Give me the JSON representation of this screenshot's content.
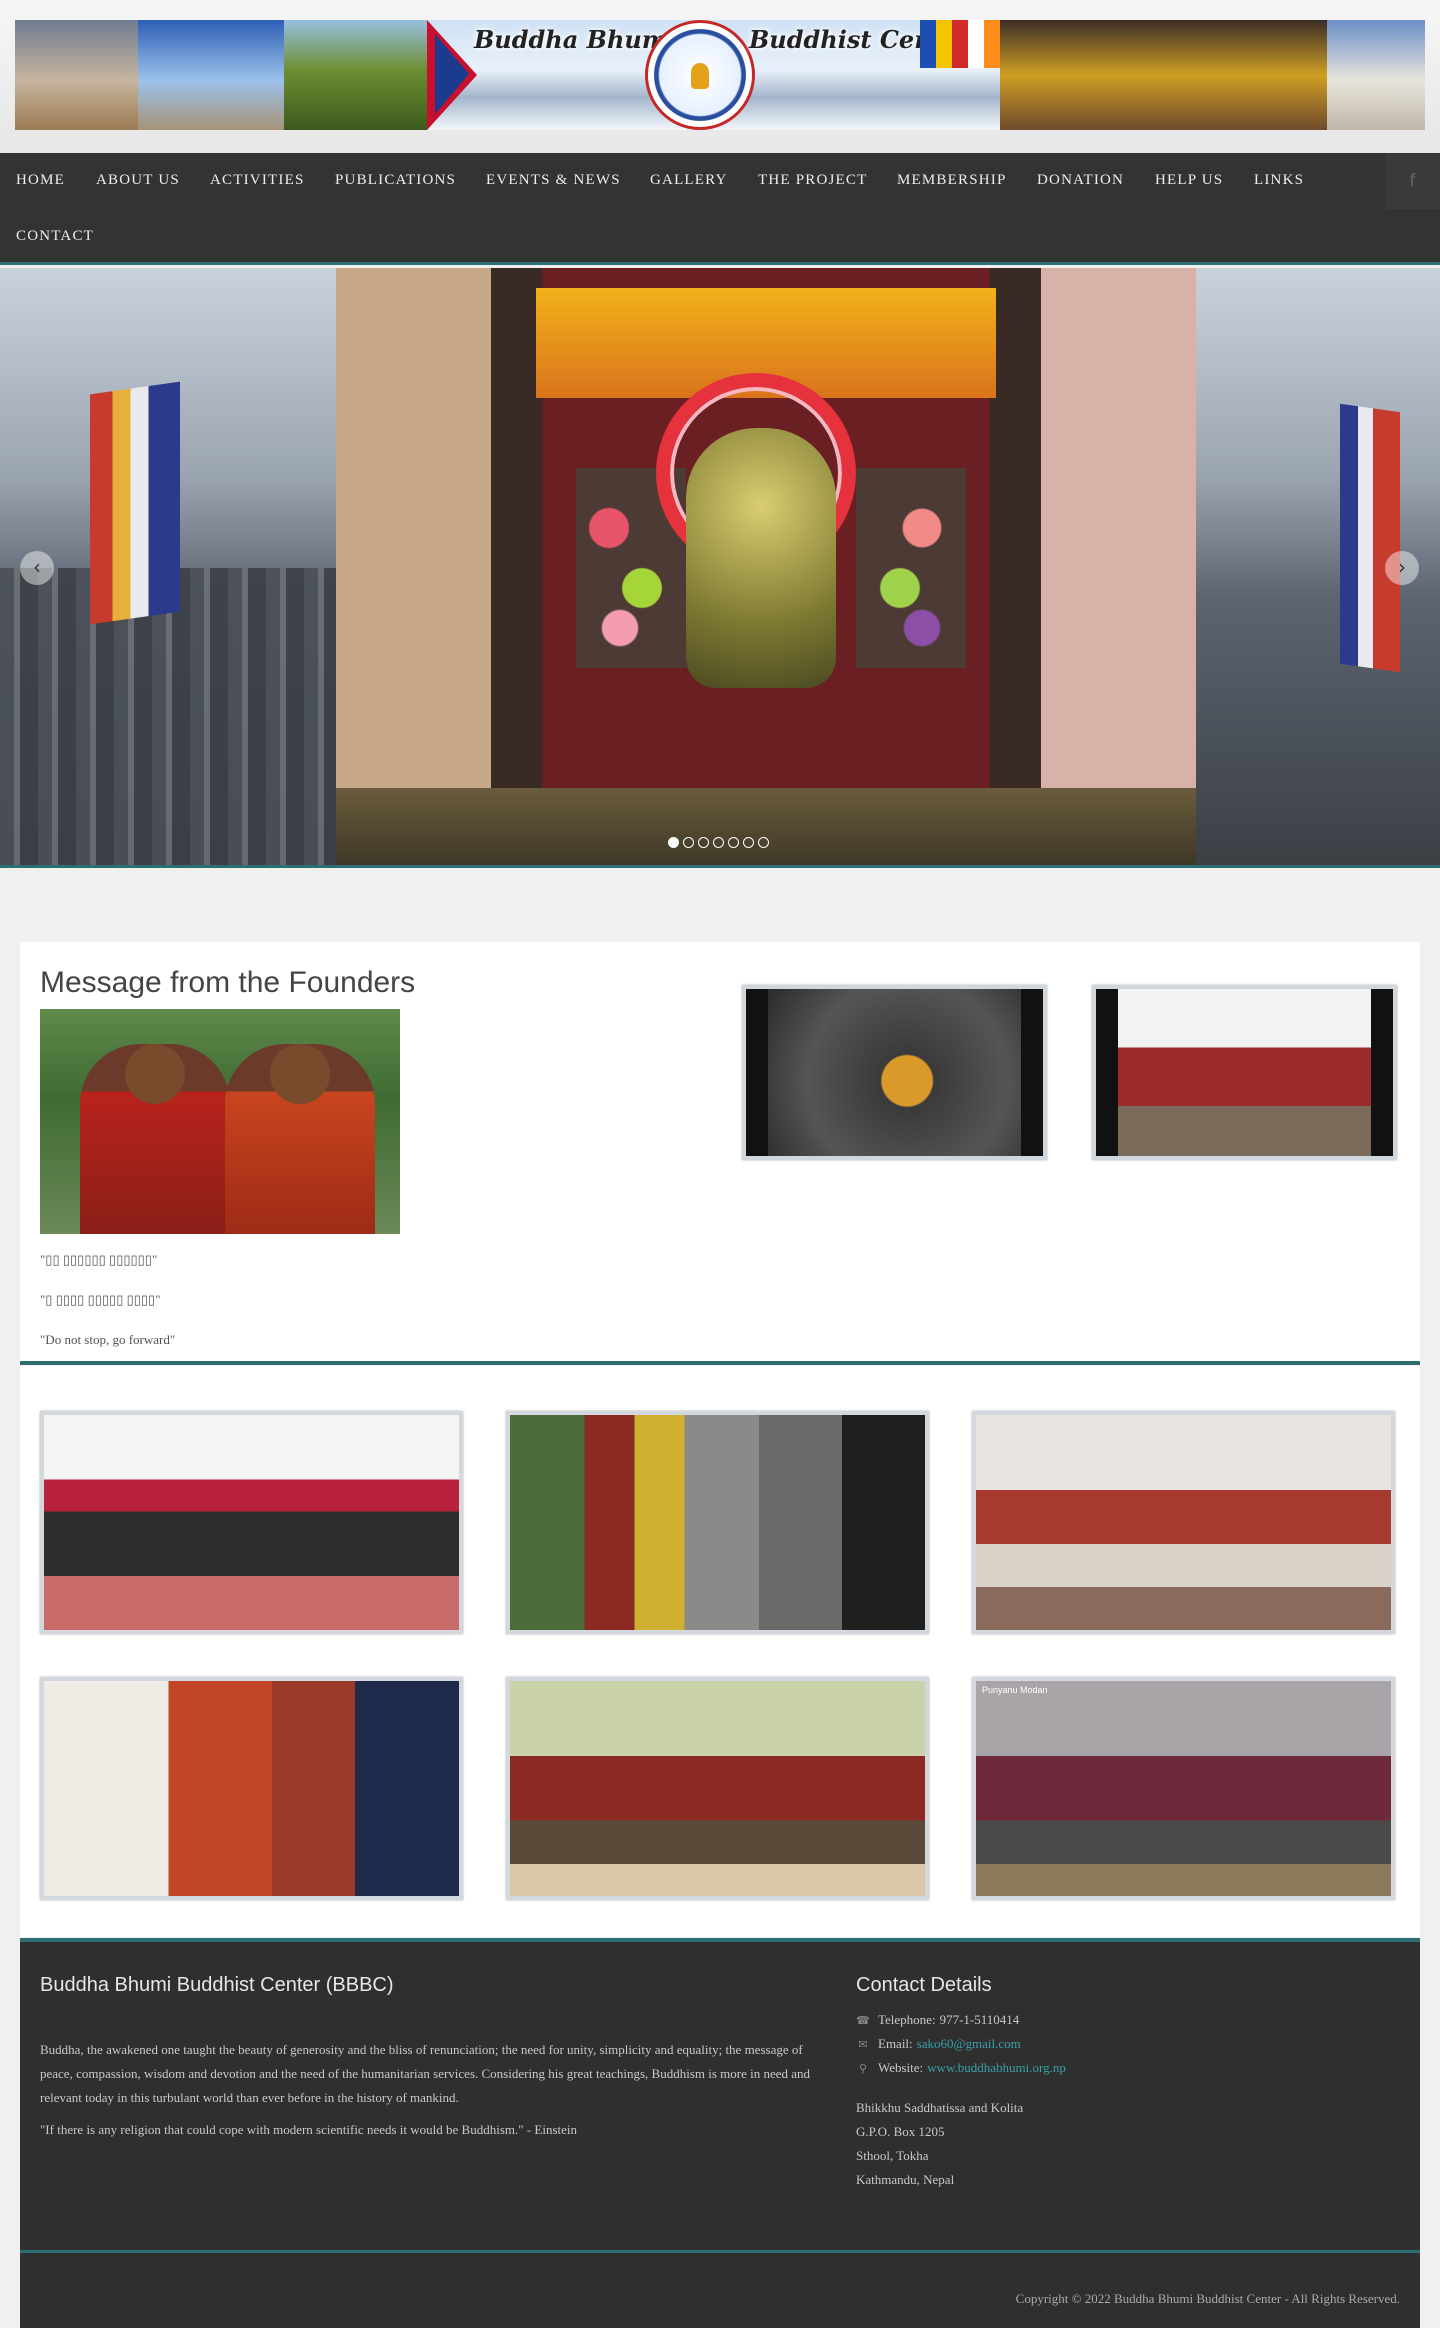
{
  "banner": {
    "title_left": "Buddha Bhumi",
    "title_right": "Buddhist Center"
  },
  "nav": {
    "items": [
      "HOME",
      "ABOUT US",
      "ACTIVITIES",
      "PUBLICATIONS",
      "EVENTS & NEWS",
      "GALLERY",
      "THE PROJECT",
      "MEMBERSHIP",
      "DONATION",
      "HELP US",
      "LINKS",
      "CONTACT"
    ],
    "social_icon": "facebook-icon",
    "social_glyph": "f"
  },
  "slider": {
    "prev_glyph": "‹",
    "next_glyph": "›",
    "slide_count": 7,
    "active_index": 0
  },
  "founders": {
    "title": "Message from the Founders",
    "quotes": [
      "\"▯▯ ▯▯▯▯▯▯ ▯▯▯▯▯▯\"",
      "\"▯ ▯▯▯▯ ▯▯▯▯▯ ▯▯▯▯\"",
      "\"Do not stop, go forward\""
    ]
  },
  "gallery": {
    "caption": "Punyanu Modan"
  },
  "footer": {
    "about_title": "Buddha Bhumi Buddhist Center (BBBC)",
    "about_text": "Buddha, the awakened one taught the beauty of generosity and the bliss of renunciation; the need for unity, simplicity and equality; the message of peace, compassion, wisdom and devotion and the need of the humanitarian services. Considering his great teachings, Buddhism is more in need and relevant today in this turbulant world than ever before in the history of mankind.",
    "einstein_quote": "\"If there is any religion that could cope with modern scientific needs it would be Buddhism.\" - Einstein",
    "contact_title": "Contact Details",
    "telephone_label": "Telephone:",
    "telephone": "977-1-5110414",
    "email_label": "Email:",
    "email": "sako60@gmail.com",
    "website_label": "Website:",
    "website": "www.buddhabhumi.org.np",
    "address": [
      "Bhikkhu Saddhatissa and Kolita",
      "G.P.O. Box 1205",
      "Sthool, Tokha",
      "Kathmandu, Nepal"
    ],
    "copyright": "Copyright © 2022 Buddha Bhumi Buddhist Center - All Rights Reserved."
  },
  "colors": {
    "accent": "#2b6f73",
    "nav_bg": "#333333",
    "footer_bg": "#2f2f2f",
    "link": "#39a0a6"
  }
}
